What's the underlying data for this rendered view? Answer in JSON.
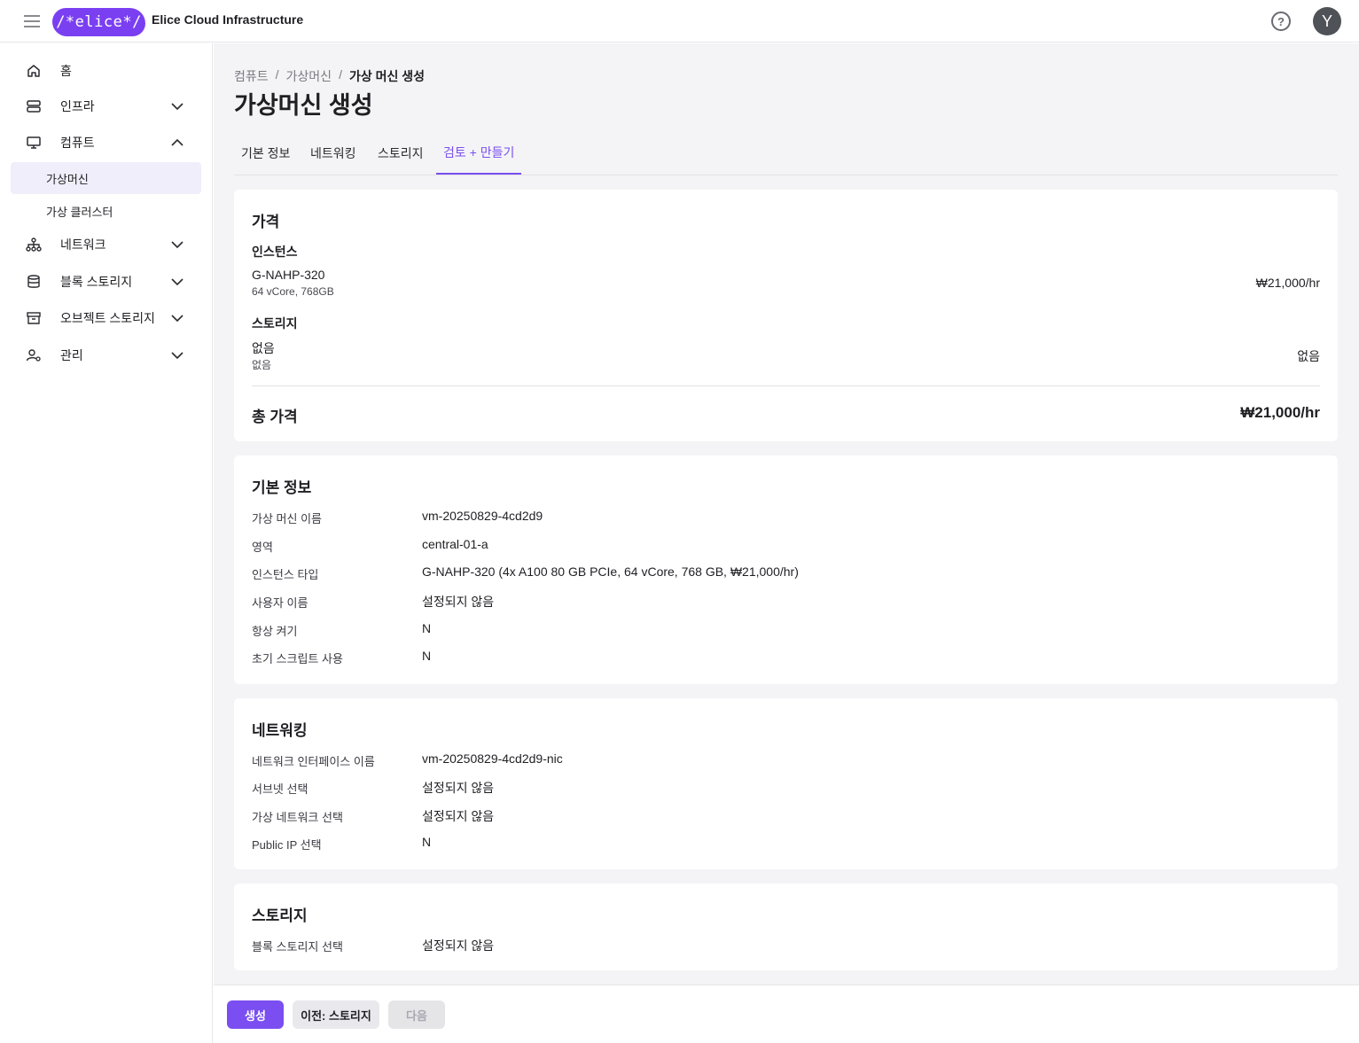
{
  "header": {
    "logo_text": "/*elice*/",
    "app_title": "Elice Cloud Infrastructure",
    "help_symbol": "?",
    "avatar_initial": "Y",
    "accent_color": "#7a4ef0"
  },
  "sidebar": {
    "items": [
      {
        "label": "홈",
        "icon": "home-icon",
        "expandable": false
      },
      {
        "label": "인프라",
        "icon": "server-icon",
        "expandable": true,
        "expanded": false
      },
      {
        "label": "컴퓨트",
        "icon": "monitor-icon",
        "expandable": true,
        "expanded": true
      },
      {
        "label": "네트워크",
        "icon": "network-icon",
        "expandable": true,
        "expanded": false
      },
      {
        "label": "블록 스토리지",
        "icon": "database-icon",
        "expandable": true,
        "expanded": false
      },
      {
        "label": "오브젝트 스토리지",
        "icon": "archive-icon",
        "expandable": true,
        "expanded": false
      },
      {
        "label": "관리",
        "icon": "user-gear-icon",
        "expandable": true,
        "expanded": false
      }
    ],
    "compute_children": [
      {
        "label": "가상머신",
        "active": true
      },
      {
        "label": "가상 클러스터",
        "active": false
      }
    ]
  },
  "breadcrumb": {
    "items": [
      "컴퓨트",
      "가상머신",
      "가상 머신 생성"
    ],
    "separator": "/"
  },
  "page_title": "가상머신 생성",
  "tabs": [
    {
      "label": "기본 정보",
      "active": false
    },
    {
      "label": "네트워킹",
      "active": false
    },
    {
      "label": "스토리지",
      "active": false
    },
    {
      "label": "검토 + 만들기",
      "active": true
    }
  ],
  "price": {
    "title": "가격",
    "instance_heading": "인스턴스",
    "instance_name": "G-NAHP-320",
    "instance_spec": "64 vCore, 768GB",
    "instance_price": "₩21,000/hr",
    "storage_heading": "스토리지",
    "storage_name": "없음",
    "storage_spec": "없음",
    "storage_price": "없음",
    "total_label": "총 가격",
    "total_value": "₩21,000/hr"
  },
  "basic_info": {
    "title": "기본 정보",
    "rows": [
      {
        "key": "가상 머신 이름",
        "value": "vm-20250829-4cd2d9"
      },
      {
        "key": "영역",
        "value": "central-01-a"
      },
      {
        "key": "인스턴스 타입",
        "value": "G-NAHP-320 (4x A100 80 GB PCIe, 64 vCore, 768 GB, ₩21,000/hr)"
      },
      {
        "key": "사용자 이름",
        "value": "설정되지 않음"
      },
      {
        "key": "항상 켜기",
        "value": "N"
      },
      {
        "key": "초기 스크립트 사용",
        "value": "N"
      }
    ]
  },
  "networking": {
    "title": "네트워킹",
    "rows": [
      {
        "key": "네트워크 인터페이스 이름",
        "value": "vm-20250829-4cd2d9-nic"
      },
      {
        "key": "서브넷 선택",
        "value": "설정되지 않음"
      },
      {
        "key": "가상 네트워크 선택",
        "value": "설정되지 않음"
      },
      {
        "key": "Public IP 선택",
        "value": "N"
      }
    ]
  },
  "storage": {
    "title": "스토리지",
    "rows": [
      {
        "key": "블록 스토리지 선택",
        "value": "설정되지 않음"
      }
    ]
  },
  "footer": {
    "create_label": "생성",
    "prev_label": "이전: 스토리지",
    "next_label": "다음"
  }
}
